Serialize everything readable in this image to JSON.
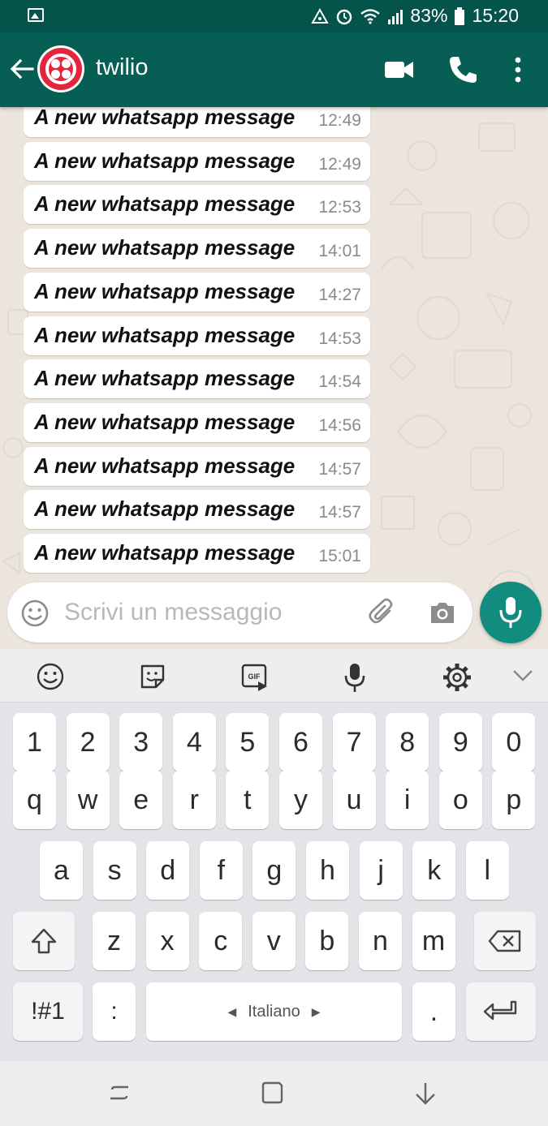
{
  "status_bar": {
    "battery": "83%",
    "time": "15:20",
    "icons": [
      "gallery-icon",
      "hotspot-icon",
      "alarm-icon",
      "wifi-icon",
      "signal-icon",
      "battery-icon"
    ]
  },
  "app_bar": {
    "contact_name": "twilio",
    "icons": [
      "back-arrow-icon",
      "twilio-logo-avatar",
      "video-call-icon",
      "phone-call-icon",
      "more-vert-icon"
    ],
    "colors": {
      "bar": "#075e54",
      "status": "#05544c",
      "avatar_red": "#e3263d"
    }
  },
  "chat": {
    "messages": [
      {
        "text": "A new whatsapp message",
        "time": "12:49"
      },
      {
        "text": "A new whatsapp message",
        "time": "12:49"
      },
      {
        "text": "A new whatsapp message",
        "time": "12:53"
      },
      {
        "text": "A new whatsapp message",
        "time": "14:01"
      },
      {
        "text": "A new whatsapp message",
        "time": "14:27"
      },
      {
        "text": "A new whatsapp message",
        "time": "14:53"
      },
      {
        "text": "A new whatsapp message",
        "time": "14:54"
      },
      {
        "text": "A new whatsapp message",
        "time": "14:56"
      },
      {
        "text": "A new whatsapp message",
        "time": "14:57"
      },
      {
        "text": "A new whatsapp message",
        "time": "14:57"
      },
      {
        "text": "A new whatsapp message",
        "time": "15:01"
      }
    ]
  },
  "compose": {
    "placeholder": "Scrivi un messaggio",
    "icons": [
      "emoji-icon",
      "attach-clip-icon",
      "camera-icon",
      "mic-icon"
    ],
    "accent": "#128c7e"
  },
  "keyboard": {
    "toolbar_icons": [
      "emoji-icon",
      "sticker-icon",
      "gif-icon",
      "voice-input-icon",
      "settings-gear-icon",
      "collapse-chevron-icon"
    ],
    "row_numbers": [
      "1",
      "2",
      "3",
      "4",
      "5",
      "6",
      "7",
      "8",
      "9",
      "0"
    ],
    "row_top": [
      "q",
      "w",
      "e",
      "r",
      "t",
      "y",
      "u",
      "i",
      "o",
      "p"
    ],
    "row_middle": [
      "a",
      "s",
      "d",
      "f",
      "g",
      "h",
      "j",
      "k",
      "l"
    ],
    "row_bottom": [
      "z",
      "x",
      "c",
      "v",
      "b",
      "n",
      "m"
    ],
    "symbols_label": "!#1",
    "colon_label": ":",
    "space_label": "Italiano",
    "period_label": ".",
    "special_icons": [
      "shift-icon",
      "backspace-icon",
      "enter-icon"
    ]
  },
  "nav_bar": {
    "icons": [
      "recent-apps-icon",
      "home-icon",
      "back-down-icon"
    ]
  }
}
